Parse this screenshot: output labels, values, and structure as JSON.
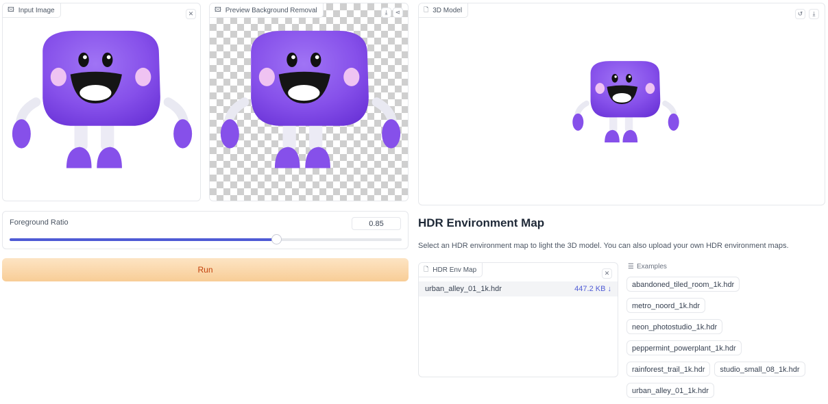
{
  "input_panel": {
    "label": "Input Image",
    "icon": "image-icon",
    "close_glyph": "✕"
  },
  "preview_panel": {
    "label": "Preview Background Removal",
    "icon": "image-icon",
    "download_glyph": "⤓",
    "share_glyph": "⋖"
  },
  "model_panel": {
    "label": "3D Model",
    "icon": "file-icon",
    "reset_glyph": "↺",
    "download_glyph": "⤓"
  },
  "slider": {
    "label": "Foreground Ratio",
    "value": "0.85",
    "fill_fraction": 0.68,
    "accent": "#4f5bd5"
  },
  "run_button": {
    "label": "Run",
    "color": "#c2410c"
  },
  "hdr": {
    "title": "HDR Environment Map",
    "description": "Select an HDR environment map to light the 3D model. You can also upload your own HDR environment maps."
  },
  "file_panel": {
    "label": "HDR Env Map",
    "close_glyph": "✕",
    "file_name": "urban_alley_01_1k.hdr",
    "file_size": "447.2 KB ↓"
  },
  "examples": {
    "label": "Examples",
    "items": [
      "abandoned_tiled_room_1k.hdr",
      "metro_noord_1k.hdr",
      "neon_photostudio_1k.hdr",
      "peppermint_powerplant_1k.hdr",
      "rainforest_trail_1k.hdr",
      "studio_small_08_1k.hdr",
      "urban_alley_01_1k.hdr"
    ]
  }
}
